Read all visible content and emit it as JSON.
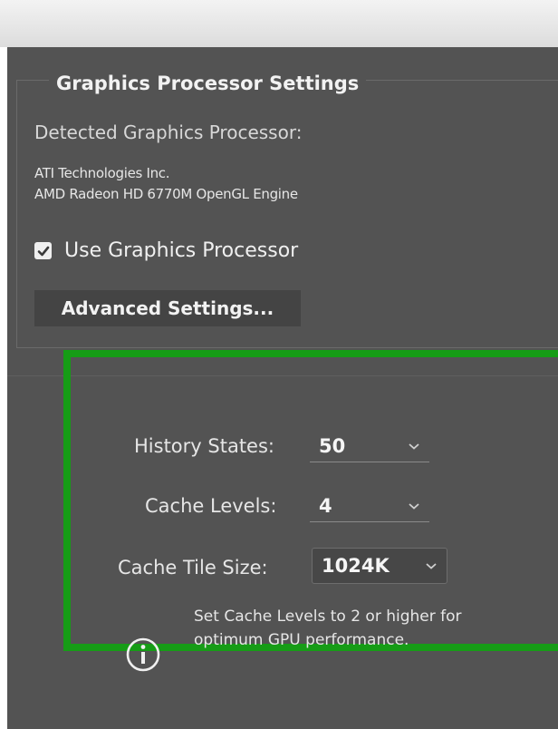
{
  "gpu_settings": {
    "title": "Graphics Processor Settings",
    "detected_label": "Detected Graphics Processor:",
    "gpu_vendor": "ATI Technologies Inc.",
    "gpu_model": "AMD Radeon HD 6770M OpenGL Engine",
    "use_gpu_label": "Use Graphics Processor",
    "use_gpu_checked": true,
    "advanced_button": "Advanced Settings..."
  },
  "performance": {
    "history_states_label": "History States:",
    "history_states_value": "50",
    "cache_levels_label": "Cache Levels:",
    "cache_levels_value": "4",
    "cache_tile_size_label": "Cache Tile Size:",
    "cache_tile_size_value": "1024K",
    "info_line_1": "Set Cache Levels to 2 or higher for",
    "info_line_2": "optimum GPU performance.",
    "highlight_color": "#169c16"
  },
  "icons": [
    "checkmark-icon",
    "chevron-down-icon",
    "info-icon"
  ]
}
